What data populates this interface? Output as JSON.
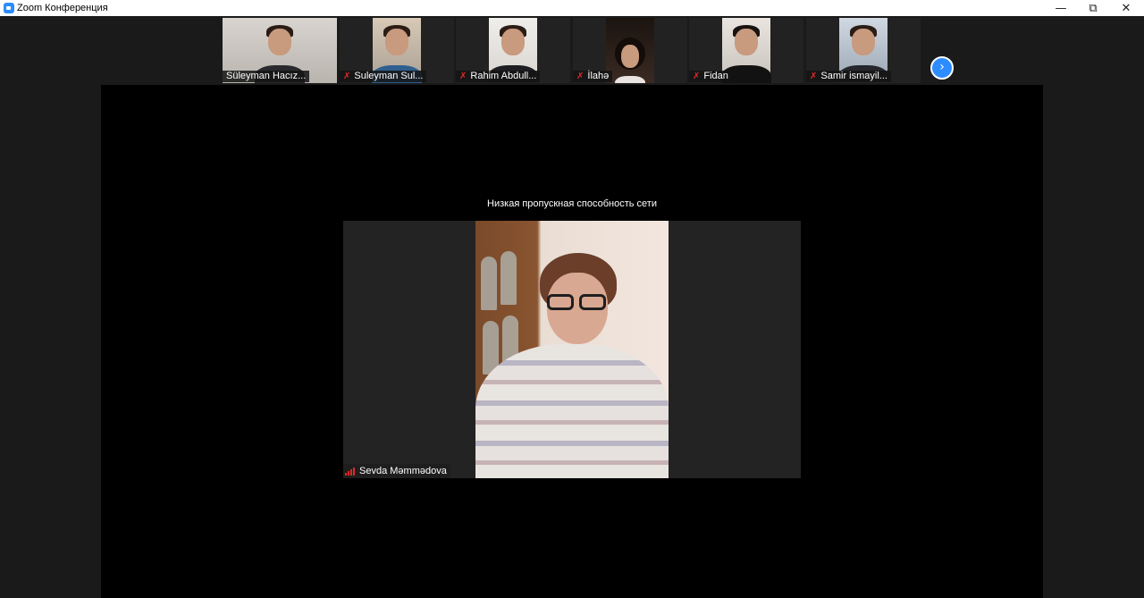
{
  "window": {
    "title": "Zoom Конференция",
    "minimize_glyph": "—",
    "restore_glyph": "⧉",
    "close_glyph": "✕"
  },
  "participants": [
    {
      "name": "Süleyman Hacız...",
      "muted": false
    },
    {
      "name": "Suleyman Sul...",
      "muted": true
    },
    {
      "name": "Rahim Abdull...",
      "muted": true
    },
    {
      "name": "İlahə",
      "muted": true
    },
    {
      "name": "Fidan",
      "muted": true
    },
    {
      "name": "Samir ismayil...",
      "muted": true
    }
  ],
  "next_page_glyph": "›",
  "stage": {
    "network_warning": "Низкая пропускная способность сети",
    "active_speaker": "Sevda Məmmədova"
  },
  "icons": {
    "muted_mic": "muted-microphone-icon",
    "signal": "signal-strength-icon",
    "next": "chevron-right-icon"
  },
  "colors": {
    "accent": "#2d8cff",
    "muted": "#e02828",
    "background": "#1a1a1a",
    "stage": "#000000"
  }
}
